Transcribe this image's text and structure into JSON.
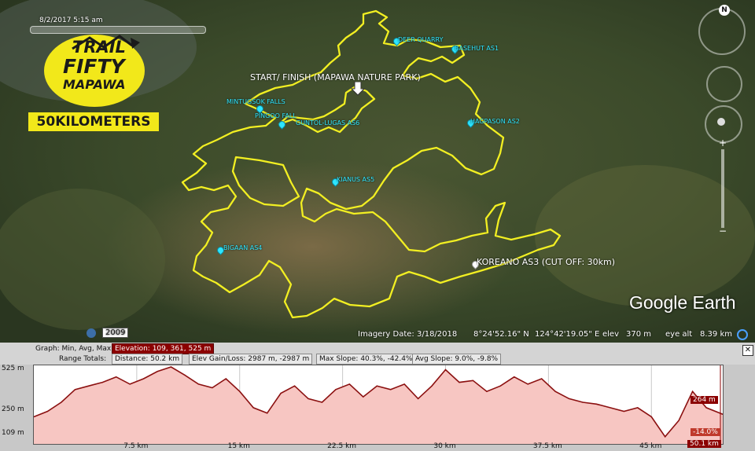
{
  "logo": {
    "trail": "TRAIL",
    "fifty": "FIFTY",
    "mapawa": "MAPAWA",
    "distance_badge": "50KILOMETERS"
  },
  "time_slider": {
    "label": "8/2/2017  5:15 am"
  },
  "map_labels": {
    "start_finish": "START/ FINISH (MAPAWA NATURE PARK)",
    "koreano": "KOREANO AS3 (CUT OFF: 30km)",
    "deer_quarry": "DEER QUARRY",
    "basehut": "BASEHUT AS1",
    "mintugsok": "MINTUGSOK FALLS",
    "pingoo": "PINGOO FALL",
    "guntol": "GUNTOL-LUGAS AS6",
    "hagpason": "HAGPASON AS2",
    "kianus": "KIANUS AS5",
    "bigaan": "BIGAAN AS4"
  },
  "watermark": "Google Earth",
  "status": {
    "year": "2009",
    "imagery_date": "Imagery Date: 3/18/2018",
    "latitude": "8°24'52.16\" N",
    "longitude": "124°42'19.05\" E",
    "elev_label": "elev",
    "elev_value": "370 m",
    "eye_alt_label": "eye alt",
    "eye_alt_value": "8.39 km"
  },
  "profile": {
    "graph_label": "Graph:  Min, Avg, Max",
    "elevation": "Elevation: 109, 361, 525 m",
    "range_label": "Range Totals:",
    "distance": "Distance: 50.2 km",
    "gain_loss": "Elev Gain/Loss: 2987 m, -2987 m",
    "max_slope": "Max Slope: 40.3%, -42.4%",
    "avg_slope": "Avg Slope: 9.0%, -9.8%",
    "current_elev": "264 m",
    "current_slope": "-14.0%",
    "current_dist": "50.1 km",
    "close": "✕"
  },
  "chart_data": {
    "type": "area",
    "title": "",
    "xlabel": "",
    "ylabel": "",
    "x_ticks": [
      "7.5 km",
      "15 km",
      "22.5 km",
      "30 km",
      "37.5 km",
      "45 km"
    ],
    "y_ticks": [
      "525 m",
      "250 m",
      "109 m"
    ],
    "ylim": [
      109,
      525
    ],
    "xlim": [
      0,
      50.2
    ],
    "x": [
      0,
      1,
      2,
      3,
      4,
      5,
      6,
      7,
      8,
      9,
      10,
      11,
      12,
      13,
      14,
      15,
      16,
      17,
      18,
      19,
      20,
      21,
      22,
      23,
      24,
      25,
      26,
      27,
      28,
      29,
      30,
      31,
      32,
      33,
      34,
      35,
      36,
      37,
      38,
      39,
      40,
      41,
      42,
      43,
      44,
      45,
      46,
      47,
      48,
      49,
      50.2
    ],
    "y": [
      250,
      280,
      330,
      400,
      420,
      440,
      470,
      430,
      460,
      500,
      525,
      480,
      430,
      410,
      460,
      390,
      300,
      270,
      380,
      420,
      350,
      330,
      400,
      430,
      360,
      420,
      400,
      430,
      350,
      420,
      510,
      440,
      450,
      390,
      420,
      470,
      430,
      460,
      390,
      350,
      330,
      320,
      300,
      280,
      300,
      250,
      140,
      230,
      390,
      300,
      264
    ],
    "series": [
      {
        "name": "",
        "color": "#8b1010"
      }
    ]
  }
}
